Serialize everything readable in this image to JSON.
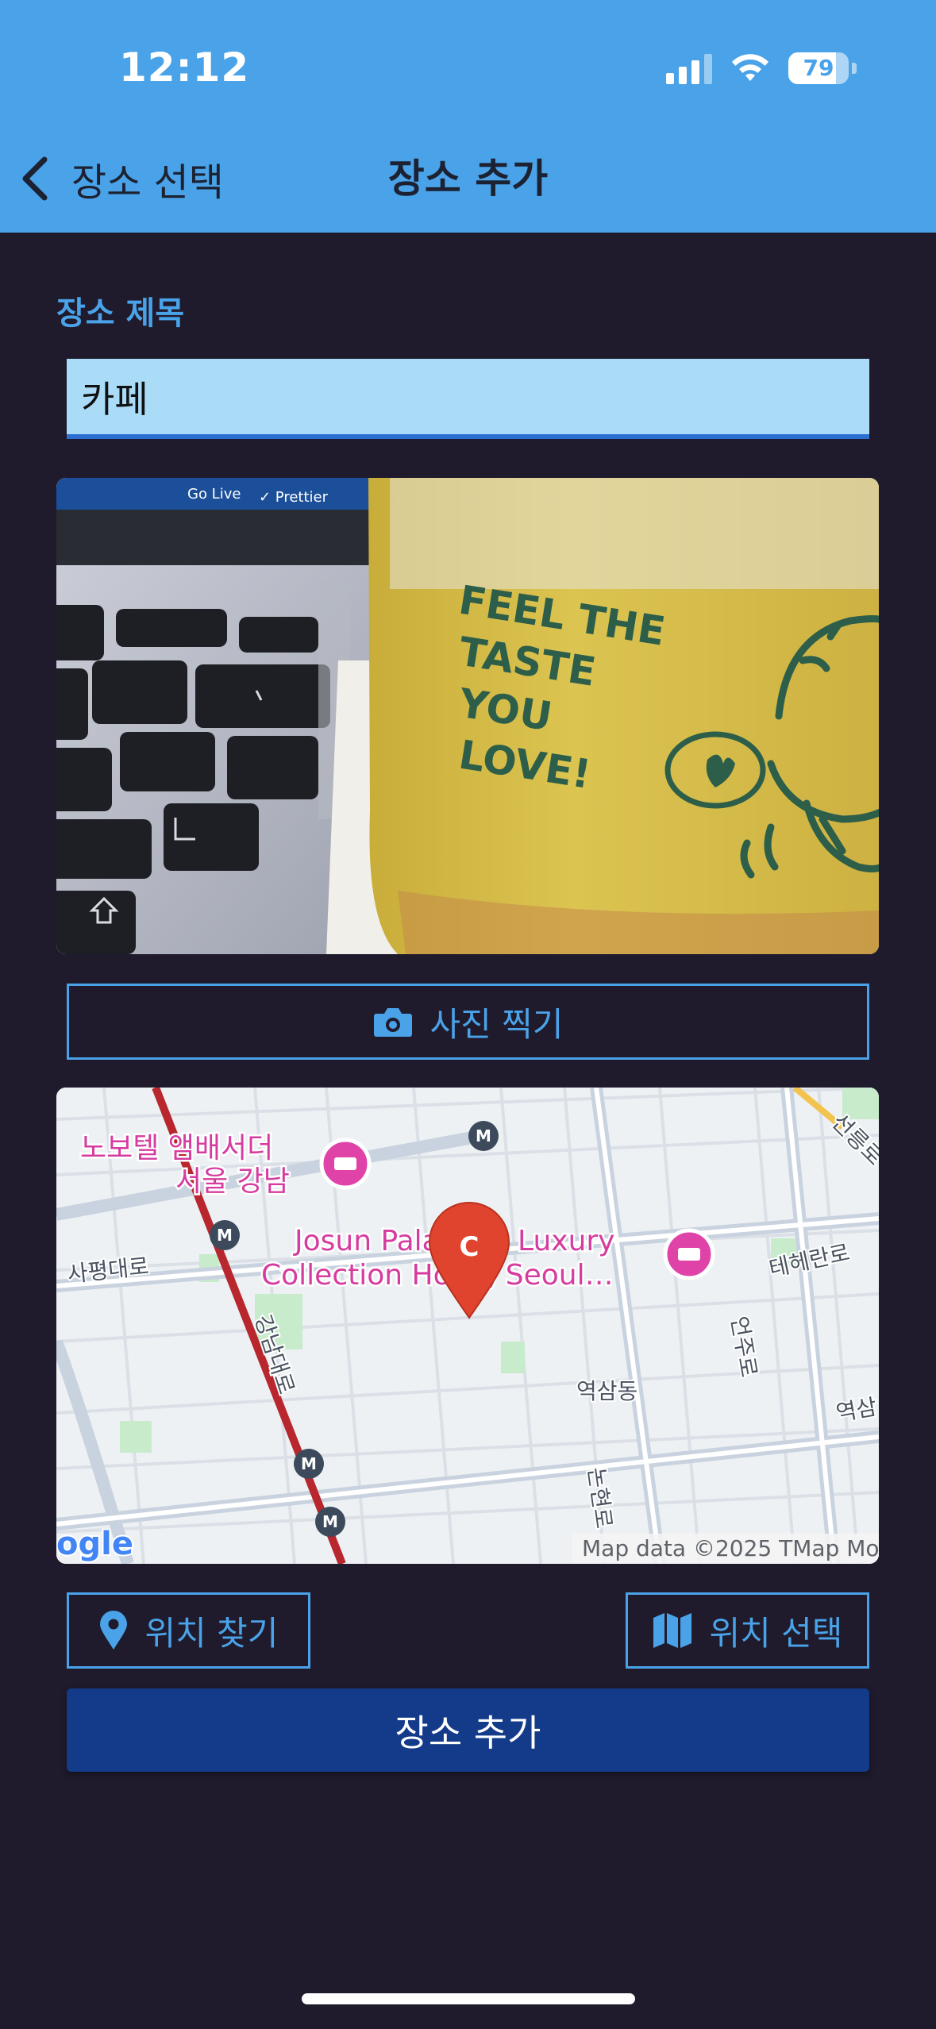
{
  "status_bar": {
    "time": "12:12",
    "battery": "79",
    "battery_level": 0.79,
    "signal_bars": 3
  },
  "nav": {
    "back_label": "장소 선택",
    "title": "장소 추가",
    "back_icon": "chevron-left-icon"
  },
  "form": {
    "title_label": "장소 제목",
    "title_value": "카페",
    "photo": {
      "cup_text": [
        "FEEL THE",
        "TASTE",
        "YOU",
        "LOVE!"
      ],
      "toolbar_text": [
        "Go Live",
        "✓ Prettier"
      ],
      "description_icon": "photo"
    },
    "camera_button": {
      "label": "사진 찍기",
      "icon": "camera-icon"
    },
    "map": {
      "labels": {
        "hotel1_line1": "노보텔 앰배서더",
        "hotel1_line2": "서울 강남",
        "hotel2_line1": "Josun Palace, a Luxury",
        "hotel2_line2": "Collection Hotel, Seoul…",
        "road_sapyeong": "사평대로",
        "road_gangnam": "강남대로",
        "road_teheran": "테헤란로",
        "road_eonju": "언주로",
        "road_nonhyeon": "논현로",
        "road_seolleung": "선릉로",
        "district": "역삼동",
        "station_edge": "역삼",
        "marker": "C",
        "metro": "M",
        "logo": "ogle",
        "attribution": "Map data ©2025 TMap Mo"
      },
      "colors": {
        "marker": "#e0442f",
        "poi": "#e043a8",
        "main_road": "#b8262e"
      }
    },
    "find_location_button": {
      "label": "위치 찾기",
      "icon": "map-pin-icon"
    },
    "select_location_button": {
      "label": "위치 선택",
      "icon": "map-icon"
    },
    "submit_button": {
      "label": "장소 추가"
    }
  },
  "colors": {
    "header": "#4aa3e8",
    "background": "#1f1b2d",
    "accent": "#4aa3e8",
    "input_bg": "#aadcf8",
    "primary_button": "#143a8a"
  }
}
